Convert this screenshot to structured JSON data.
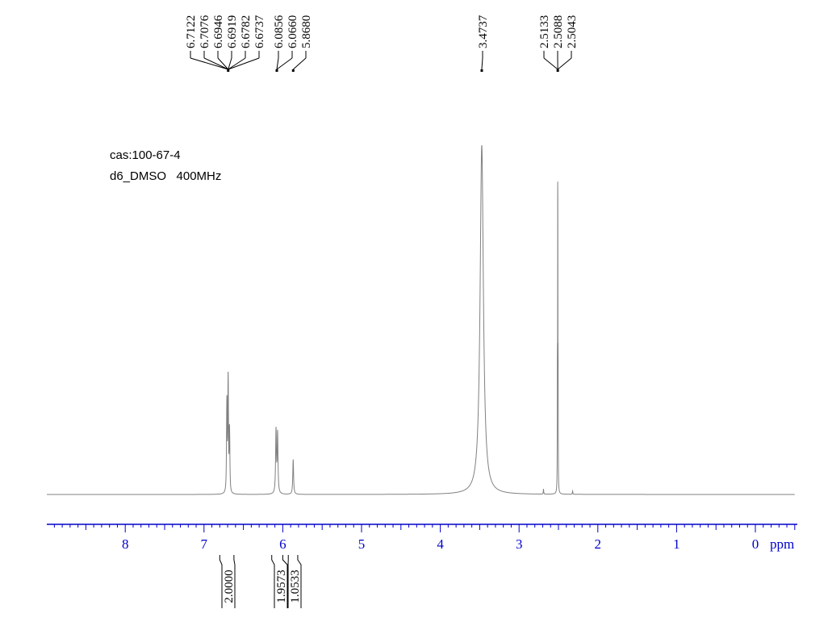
{
  "info": {
    "line1": "cas:100-67-4",
    "line2": "d6_DMSO   400MHz"
  },
  "chart_data": {
    "type": "line",
    "x_unit_label": "ppm",
    "xlim": [
      9.0,
      -0.5
    ],
    "x_ticks": [
      8,
      7,
      6,
      5,
      4,
      3,
      2,
      1,
      0
    ],
    "x_tick_labels": [
      "8",
      "7",
      "6",
      "5",
      "4",
      "3",
      "2",
      "1",
      "0"
    ],
    "colors": {
      "axis": "#0000cc",
      "trace": "#808080",
      "labels": "#000000"
    },
    "peak_labels": [
      {
        "ppm": 6.7122,
        "label": "6.7122"
      },
      {
        "ppm": 6.7076,
        "label": "6.7076"
      },
      {
        "ppm": 6.6946,
        "label": "6.6946"
      },
      {
        "ppm": 6.6919,
        "label": "6.6919"
      },
      {
        "ppm": 6.6782,
        "label": "6.6782"
      },
      {
        "ppm": 6.6737,
        "label": "6.6737"
      },
      {
        "ppm": 6.0856,
        "label": "6.0856"
      },
      {
        "ppm": 6.066,
        "label": "6.0660"
      },
      {
        "ppm": 5.868,
        "label": "5.8680"
      },
      {
        "ppm": 3.4737,
        "label": "3.4737"
      },
      {
        "ppm": 2.5133,
        "label": "2.5133"
      },
      {
        "ppm": 2.5088,
        "label": "2.5088"
      },
      {
        "ppm": 2.5043,
        "label": "2.5043"
      }
    ],
    "integrals": [
      {
        "ppm_start": 6.8,
        "ppm_end": 6.62,
        "value": "2.0000"
      },
      {
        "ppm_start": 6.14,
        "ppm_end": 6.0,
        "value": "1.9573"
      },
      {
        "ppm_start": 5.93,
        "ppm_end": 5.81,
        "value": "1.0533"
      }
    ],
    "peaks": [
      {
        "ppm": 6.712,
        "height": 0.14,
        "width": 0.004
      },
      {
        "ppm": 6.708,
        "height": 0.18,
        "width": 0.004
      },
      {
        "ppm": 6.695,
        "height": 0.2,
        "width": 0.004
      },
      {
        "ppm": 6.692,
        "height": 0.17,
        "width": 0.004
      },
      {
        "ppm": 6.678,
        "height": 0.12,
        "width": 0.004
      },
      {
        "ppm": 6.674,
        "height": 0.1,
        "width": 0.004
      },
      {
        "ppm": 6.086,
        "height": 0.18,
        "width": 0.006
      },
      {
        "ppm": 6.066,
        "height": 0.17,
        "width": 0.006
      },
      {
        "ppm": 5.868,
        "height": 0.1,
        "width": 0.006
      },
      {
        "ppm": 3.4737,
        "height": 1.0,
        "width": 0.025
      },
      {
        "ppm": 2.5133,
        "height": 0.35,
        "width": 0.0015
      },
      {
        "ppm": 2.5088,
        "height": 1.0,
        "width": 0.0015
      },
      {
        "ppm": 2.5043,
        "height": 0.35,
        "width": 0.0015
      },
      {
        "ppm": 2.69,
        "height": 0.015,
        "width": 0.003
      },
      {
        "ppm": 2.32,
        "height": 0.01,
        "width": 0.003
      }
    ]
  }
}
